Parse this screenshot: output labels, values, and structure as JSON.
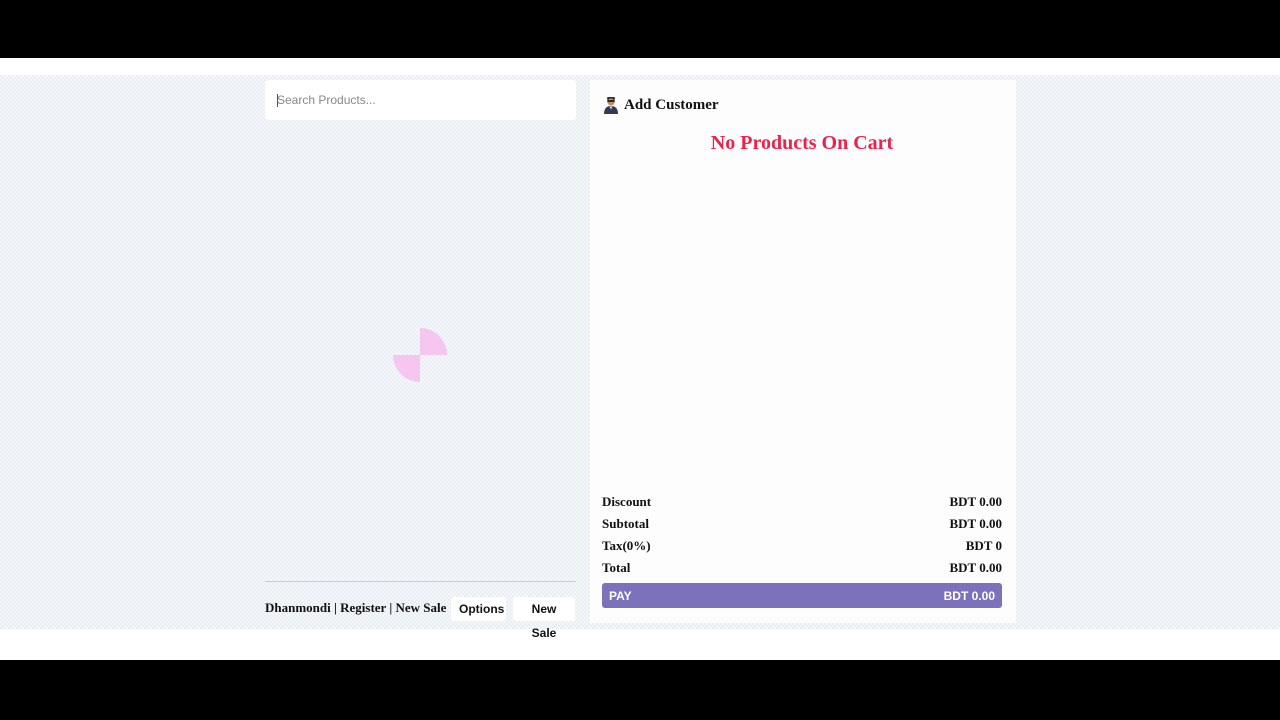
{
  "search": {
    "placeholder": "Search Products..."
  },
  "footer": {
    "location_info": "Dhanmondi | Register | New Sale",
    "options_label": "Options",
    "new_sale_label": "New Sale"
  },
  "cart": {
    "add_customer_label": "Add Customer",
    "add_customer_icon": "person-icon",
    "empty_message": "No Products On Cart",
    "totals": {
      "discount_label": "Discount",
      "discount_value": "BDT 0.00",
      "subtotal_label": "Subtotal",
      "subtotal_value": "BDT 0.00",
      "tax_label": "Tax(0%)",
      "tax_value": "BDT 0",
      "total_label": "Total",
      "total_value": "BDT 0.00"
    },
    "pay_label": "PAY",
    "pay_amount": "BDT 0.00"
  },
  "colors": {
    "accent_pay": "#7b72bb",
    "empty_message": "#e8234d",
    "spinner": "#f5c6ef"
  }
}
